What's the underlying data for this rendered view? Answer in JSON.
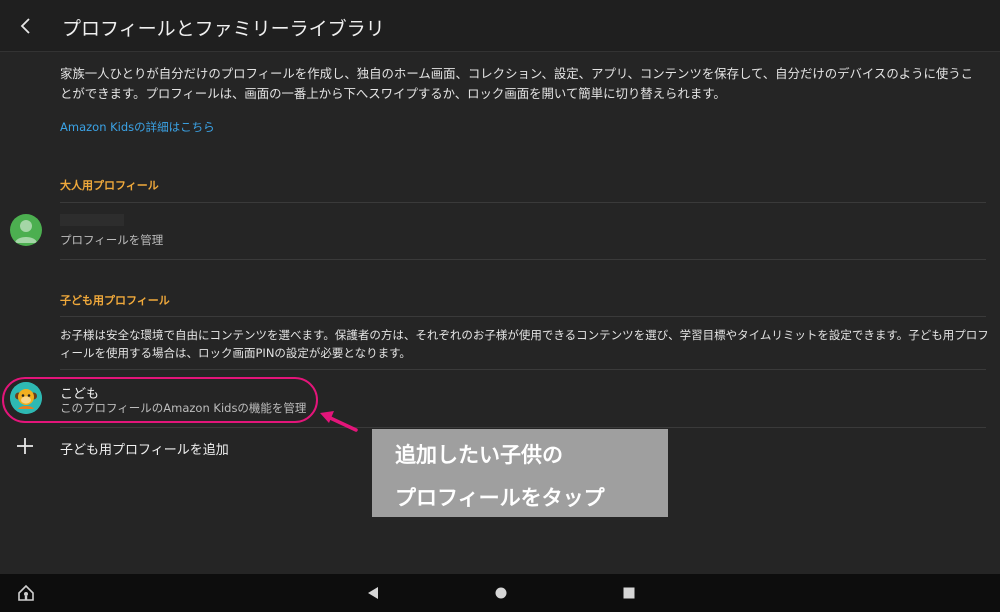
{
  "header": {
    "title": "プロフィールとファミリーライブラリ"
  },
  "intro": {
    "text": "家族一人ひとりが自分だけのプロフィールを作成し、独自のホーム画面、コレクション、設定、アプリ、コンテンツを保存して、自分だけのデバイスのように使うことができます。プロフィールは、画面の一番上から下へスワイプするか、ロック画面を開いて簡単に切り替えられます。",
    "link": "Amazon Kidsの詳細はこちら"
  },
  "adult_section": {
    "heading": "大人用プロフィール",
    "profile": {
      "subtitle": "プロフィールを管理"
    }
  },
  "kids_section": {
    "heading": "子ども用プロフィール",
    "description": "お子様は安全な環境で自由にコンテンツを選べます。保護者の方は、それぞれのお子様が使用できるコンテンツを選び、学習目標やタイムリミットを設定できます。子ども用プロフィールを使用する場合は、ロック画面PINの設定が必要となります。",
    "profile": {
      "name": "こども",
      "subtitle": "このプロフィールのAmazon Kidsの機能を管理"
    },
    "add_label": "子ども用プロフィールを追加"
  },
  "callout": {
    "line1": "追加したい子供の",
    "line2": "プロフィールをタップ"
  },
  "colors": {
    "accent": "#f0a93b",
    "link": "#3ba3e6",
    "highlight": "#e3157a",
    "background": "#252525"
  },
  "icons": {
    "back": "chevron-left-icon",
    "adult_avatar": "person-avatar-icon",
    "kid_avatar": "monkey-avatar-icon",
    "add": "plus-icon",
    "nav_home": "home-icon",
    "nav_back": "triangle-back-icon",
    "nav_circle": "circle-home-icon",
    "nav_recent": "square-recent-icon"
  }
}
